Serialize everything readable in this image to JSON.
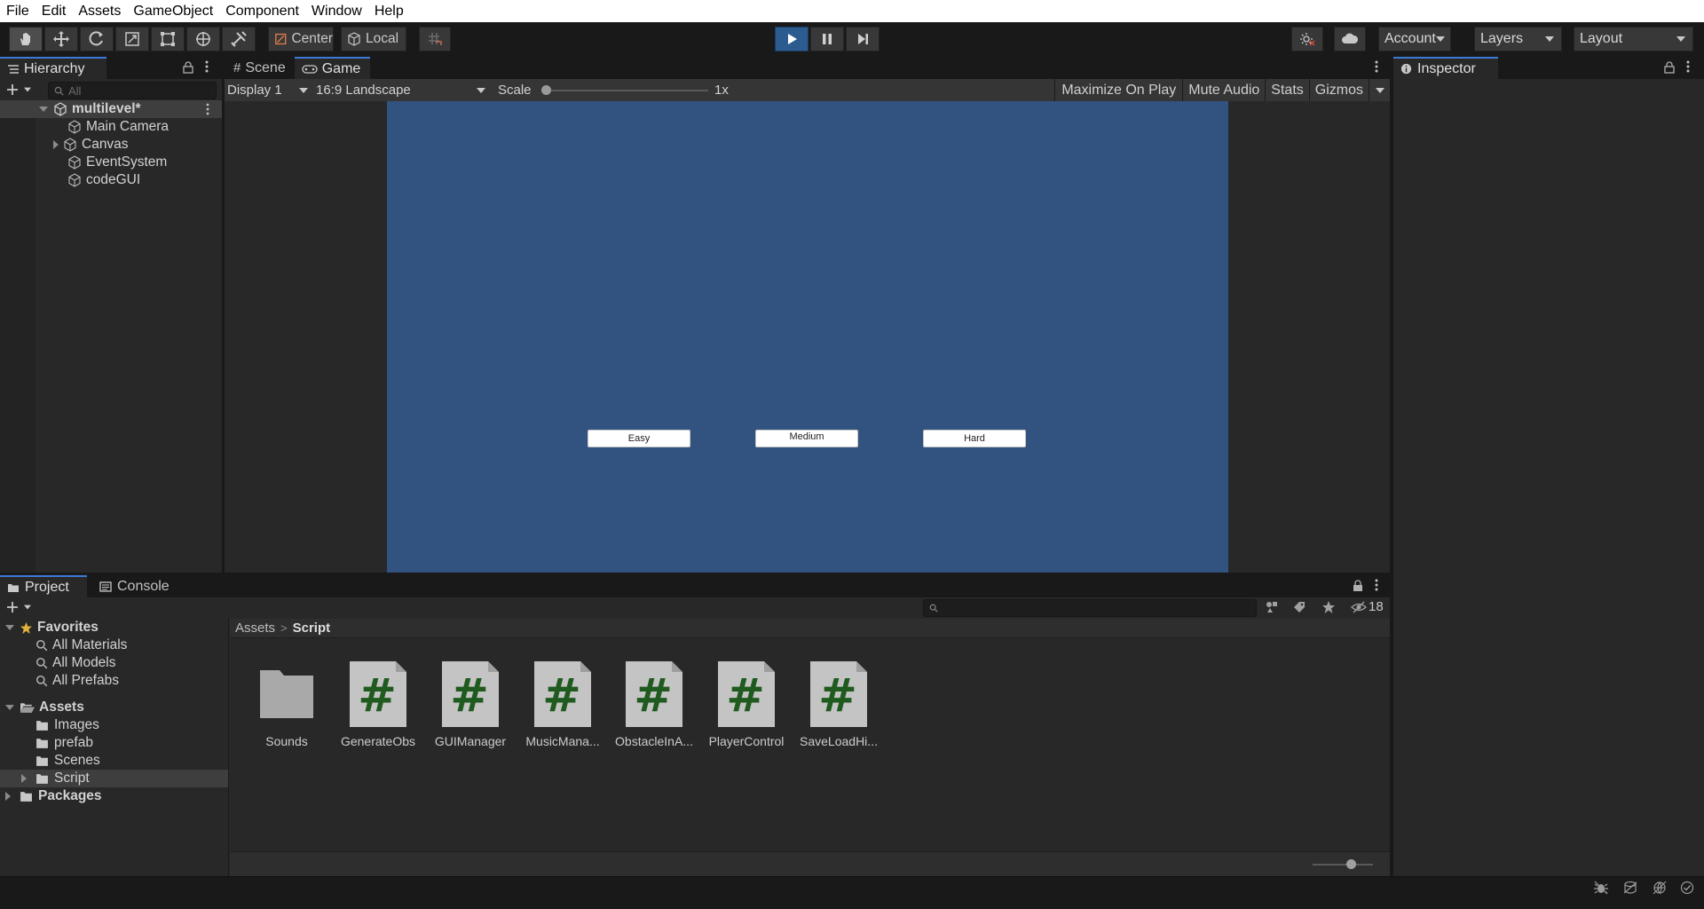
{
  "menu": [
    "File",
    "Edit",
    "Assets",
    "GameObject",
    "Component",
    "Window",
    "Help"
  ],
  "toolbar": {
    "pivot_label": "Center",
    "space_label": "Local",
    "account_label": "Account",
    "layers_label": "Layers",
    "layout_label": "Layout"
  },
  "hierarchy": {
    "tab_label": "Hierarchy",
    "search_placeholder": "All",
    "scene_name": "multilevel*",
    "items": [
      "Main Camera",
      "Canvas",
      "EventSystem",
      "codeGUI"
    ]
  },
  "game_view": {
    "tabs": [
      "Scene",
      "Game"
    ],
    "display": "Display 1",
    "aspect": "16:9 Landscape",
    "scale_label": "Scale",
    "scale_value": "1x",
    "toolbar_items": [
      "Maximize On Play",
      "Mute Audio",
      "Stats",
      "Gizmos"
    ],
    "buttons": [
      "Easy",
      "Medium",
      "Hard"
    ],
    "background_color": "#325380"
  },
  "inspector": {
    "tab_label": "Inspector"
  },
  "project": {
    "tabs": [
      "Project",
      "Console"
    ],
    "hidden_count": "18",
    "favorites_label": "Favorites",
    "favorites": [
      "All Materials",
      "All Models",
      "All Prefabs"
    ],
    "assets_label": "Assets",
    "asset_folders": [
      "Images",
      "prefab",
      "Scenes",
      "Script"
    ],
    "packages_label": "Packages",
    "breadcrumb": [
      "Assets",
      "Script"
    ],
    "files": [
      "Sounds",
      "GenerateObs",
      "GUIManager",
      "MusicMana...",
      "ObstacleInA...",
      "PlayerControl",
      "SaveLoadHi..."
    ]
  },
  "colors": {
    "accent": "#3c7ad7",
    "play_button": "#2c5c8f",
    "script_hash": "#1f5a1f"
  }
}
